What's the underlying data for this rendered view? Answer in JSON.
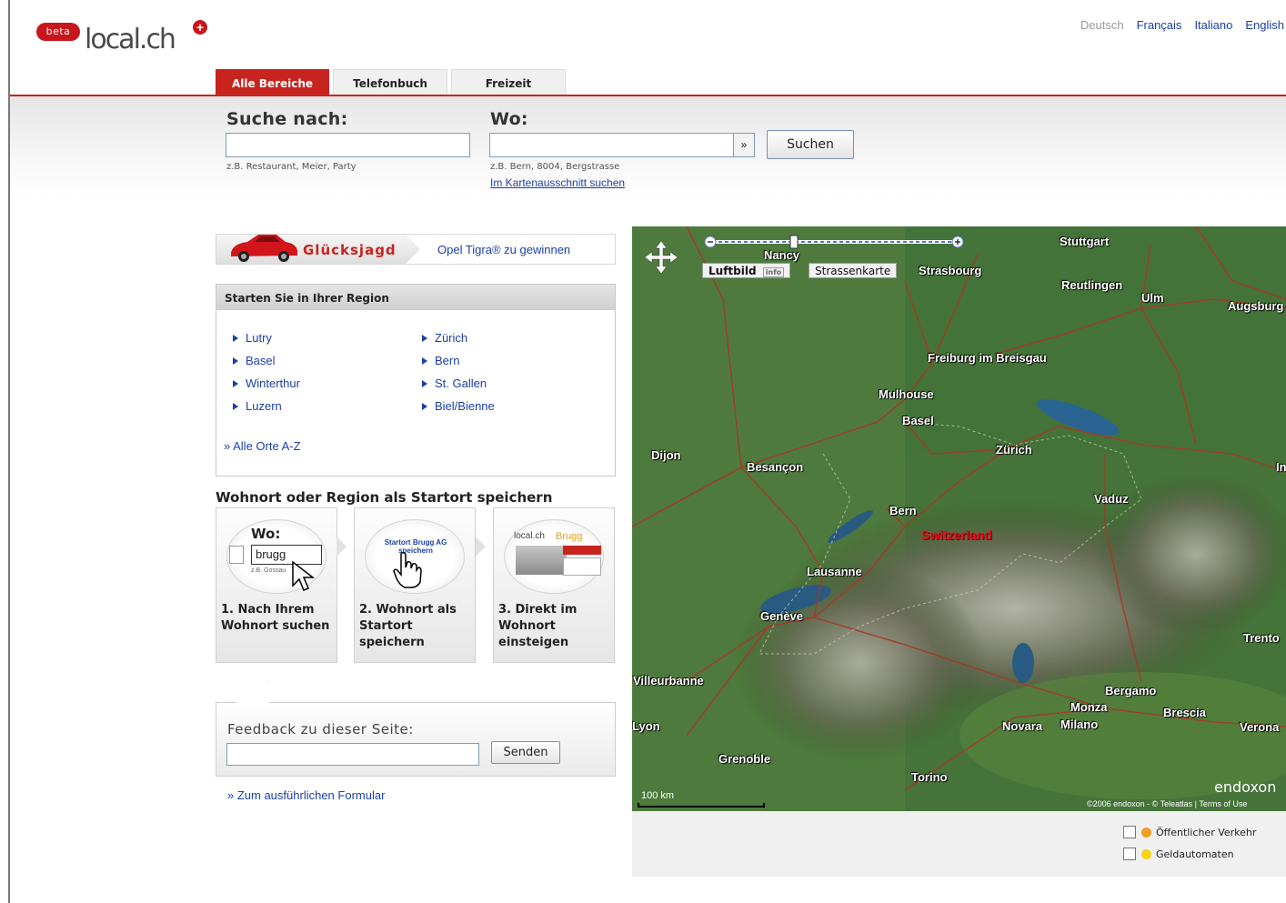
{
  "header": {
    "beta_badge": "beta",
    "logo_text": "local.ch",
    "languages": [
      "Deutsch",
      "Français",
      "Italiano",
      "English"
    ]
  },
  "tabs": [
    {
      "label": "Alle Bereiche",
      "active": true
    },
    {
      "label": "Telefonbuch",
      "active": false
    },
    {
      "label": "Freizeit",
      "active": false
    }
  ],
  "search": {
    "what_label": "Suche nach:",
    "what_value": "",
    "what_hint": "z.B. Restaurant, Meier, Party",
    "where_label": "Wo:",
    "where_value": "",
    "where_hint": "z.B. Bern, 8004, Bergstrasse",
    "dropdown_icon": "double-chevron-down",
    "submit_label": "Suchen",
    "map_section_link": "Im Kartenausschnitt suchen"
  },
  "promo": {
    "title": "Glücksjagd",
    "link": "Opel Tigra® zu gewinnen"
  },
  "regions": {
    "header": "Starten Sie in Ihrer Region",
    "col1": [
      "Lutry",
      "Basel",
      "Winterthur",
      "Luzern"
    ],
    "col2": [
      "Zürich",
      "Bern",
      "St. Gallen",
      "Biel/Bienne"
    ],
    "all_link": "» Alle Orte A-Z"
  },
  "save_start": {
    "title": "Wohnort oder Region als Startort speichern",
    "step1_wo": "Wo:",
    "step1_input": "brugg",
    "step1_hint": "z.B. Gossau",
    "step2_button": "Startort Brugg AG speichern",
    "step3_logo": "local.ch",
    "step3_place": "Brugg",
    "steps": [
      "1. Nach Ihrem Wohnort suchen",
      "2. Wohnort als Startort speichern",
      "3. Direkt im Wohnort einsteigen"
    ]
  },
  "feedback": {
    "label": "Feedback zu dieser Seite:",
    "value": "",
    "submit_label": "Senden",
    "full_form_link": "» Zum ausführlichen Formular"
  },
  "map": {
    "aerial_button": "Luftbild",
    "aerial_badge": "info",
    "street_button": "Strassenkarte",
    "country": "Switzerland",
    "cities": [
      "Stuttgart",
      "Nancy",
      "Strasbourg",
      "Reutlingen",
      "Ulm",
      "Augsburg",
      "Freiburg im Breisgau",
      "Mulhouse",
      "Basel",
      "Dijon",
      "Zürich",
      "Besançon",
      "Vaduz",
      "Bern",
      "Lausanne",
      "Genève",
      "Villeurbanne",
      "Bergamo",
      "Monza",
      "Brescia",
      "Milano",
      "Novara",
      "Verona",
      "Grenoble",
      "Torino",
      "Trento",
      "Innsbruck",
      "Lyon"
    ],
    "scale": "100 km",
    "brand": "endoxon",
    "copyright": "©2006 endoxon - © Teleatlas | Terms of Use",
    "legend": [
      {
        "label": "Öffentlicher Verkehr",
        "color": "#f0a020"
      },
      {
        "label": "Geldautomaten",
        "color": "#f4d60e"
      }
    ]
  },
  "colors": {
    "brand_red": "#c8241f",
    "link_blue": "#1a3fa8"
  }
}
